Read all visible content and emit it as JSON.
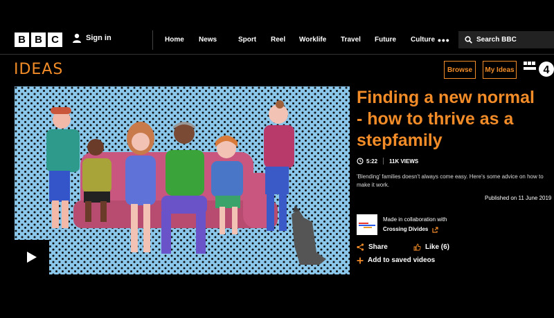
{
  "header": {
    "logo_letters": [
      "B",
      "B",
      "C"
    ],
    "signin_label": "Sign in",
    "nav": [
      "Home",
      "News",
      "Sport",
      "Reel",
      "Worklife",
      "Travel",
      "Future",
      "Culture"
    ],
    "more_label": "•••",
    "search_placeholder": "Search BBC"
  },
  "subheader": {
    "brand": "IDEAS",
    "browse_label": "Browse",
    "myideas_label": "My Ideas",
    "radio_logo_text": "BBC RADIO 4"
  },
  "video": {
    "title": [
      "Finding a new normal",
      "- how to thrive as a",
      "stepfamily"
    ],
    "duration": "5:22",
    "views": "11K VIEWS",
    "description": "'Blending' families doesn't always come easy. Here's some advice on how to make it work.",
    "published": "Published on 11 June 2019"
  },
  "collab": {
    "intro": "Made in collaboration with",
    "partner": "Crossing Divides"
  },
  "actions": {
    "share_label": "Share",
    "like_label": "Like (6)",
    "add_label": "Add to saved videos"
  },
  "colors": {
    "accent": "#f28c28",
    "background": "#000000",
    "illustration_bg": "#8bc7ea",
    "sofa": "#c9567e"
  }
}
